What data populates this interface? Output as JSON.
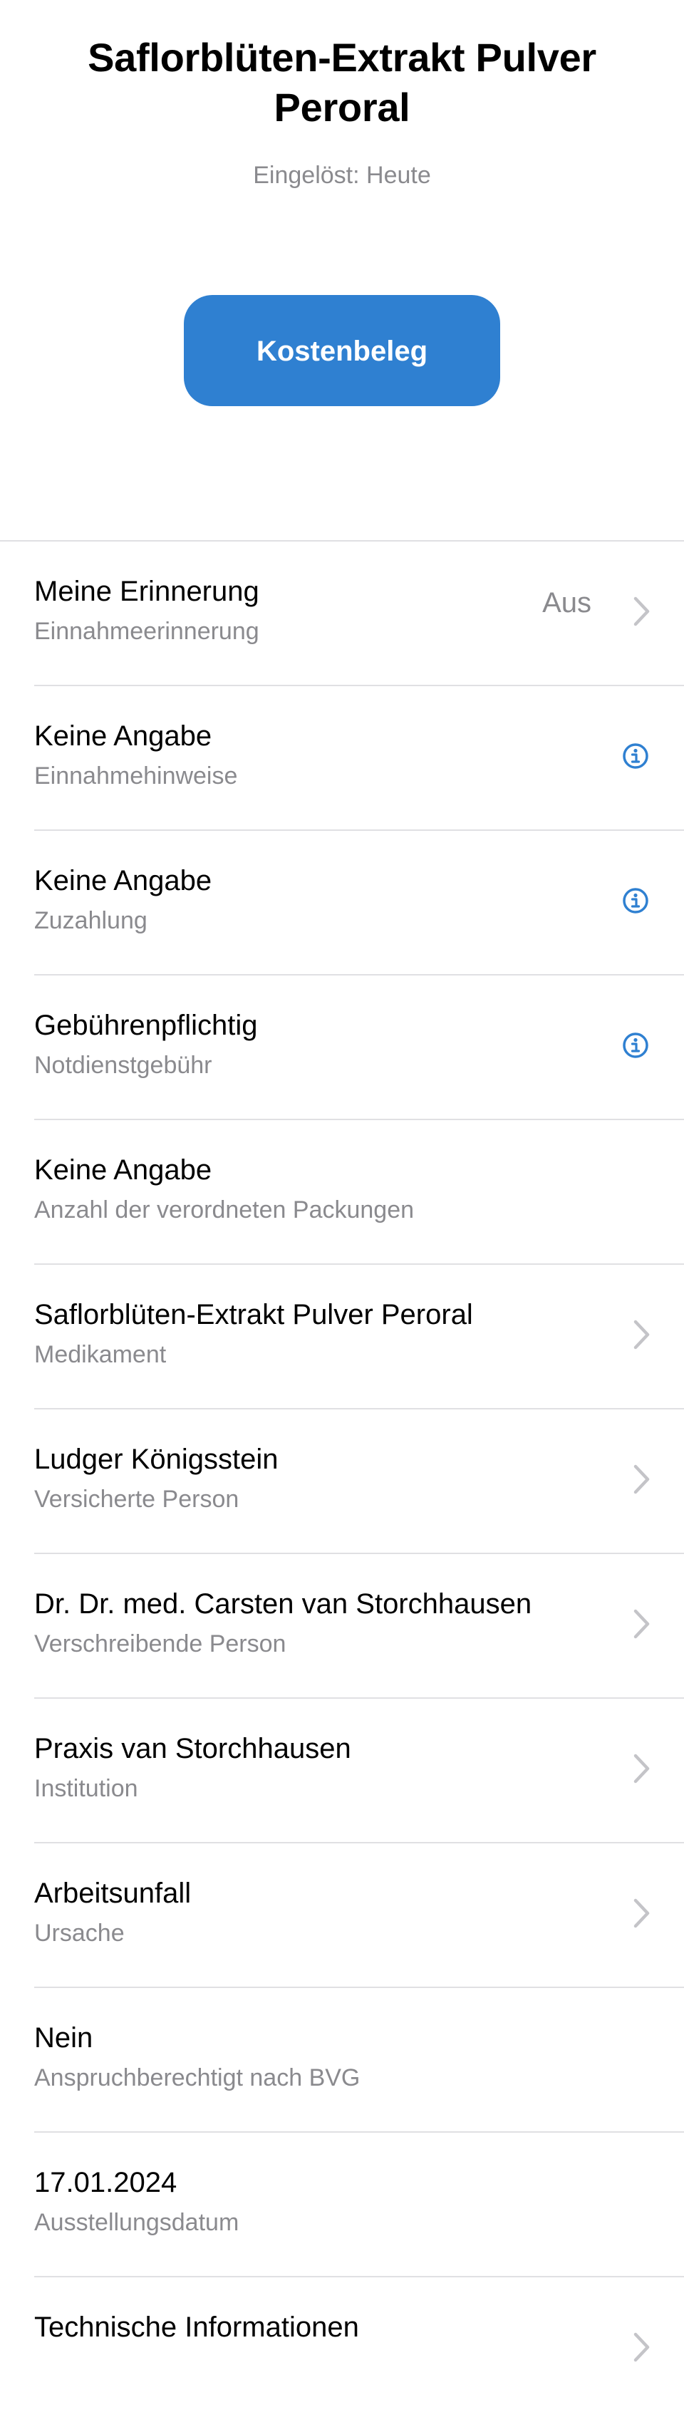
{
  "header": {
    "title": "Saflorblüten-Extrakt Pulver Peroral",
    "subtitle": "Eingelöst: Heute"
  },
  "primary_button": {
    "label": "Kostenbeleg"
  },
  "colors": {
    "accent": "#2f80d1",
    "secondary_text": "#8a8a8e",
    "separator": "#e0e0e3"
  },
  "rows": [
    {
      "title": "Meine Erinnerung",
      "subtitle": "Einnahmeerinnerung",
      "value": "Aus",
      "icon": "chevron-right-icon"
    },
    {
      "title": "Keine Angabe",
      "subtitle": "Einnahmehinweise",
      "icon": "info-icon"
    },
    {
      "title": "Keine Angabe",
      "subtitle": "Zuzahlung",
      "icon": "info-icon"
    },
    {
      "title": "Gebührenpflichtig",
      "subtitle": "Notdienstgebühr",
      "icon": "info-icon"
    },
    {
      "title": "Keine Angabe",
      "subtitle": "Anzahl der verordneten Packungen"
    },
    {
      "title": "Saflorblüten-Extrakt Pulver Peroral",
      "subtitle": "Medikament",
      "icon": "chevron-right-icon"
    },
    {
      "title": "Ludger Königsstein",
      "subtitle": "Versicherte Person",
      "icon": "chevron-right-icon"
    },
    {
      "title": "Dr. Dr. med. Carsten van Storchhausen",
      "subtitle": "Verschreibende Person",
      "icon": "chevron-right-icon"
    },
    {
      "title": "Praxis van Storchhausen",
      "subtitle": "Institution",
      "icon": "chevron-right-icon"
    },
    {
      "title": "Arbeitsunfall",
      "subtitle": "Ursache",
      "icon": "chevron-right-icon"
    },
    {
      "title": "Nein",
      "subtitle": "Anspruchberechtigt nach BVG"
    },
    {
      "title": "17.01.2024",
      "subtitle": "Ausstellungsdatum"
    },
    {
      "title": "Technische Informationen",
      "subtitle": "",
      "icon": "chevron-right-icon"
    }
  ]
}
